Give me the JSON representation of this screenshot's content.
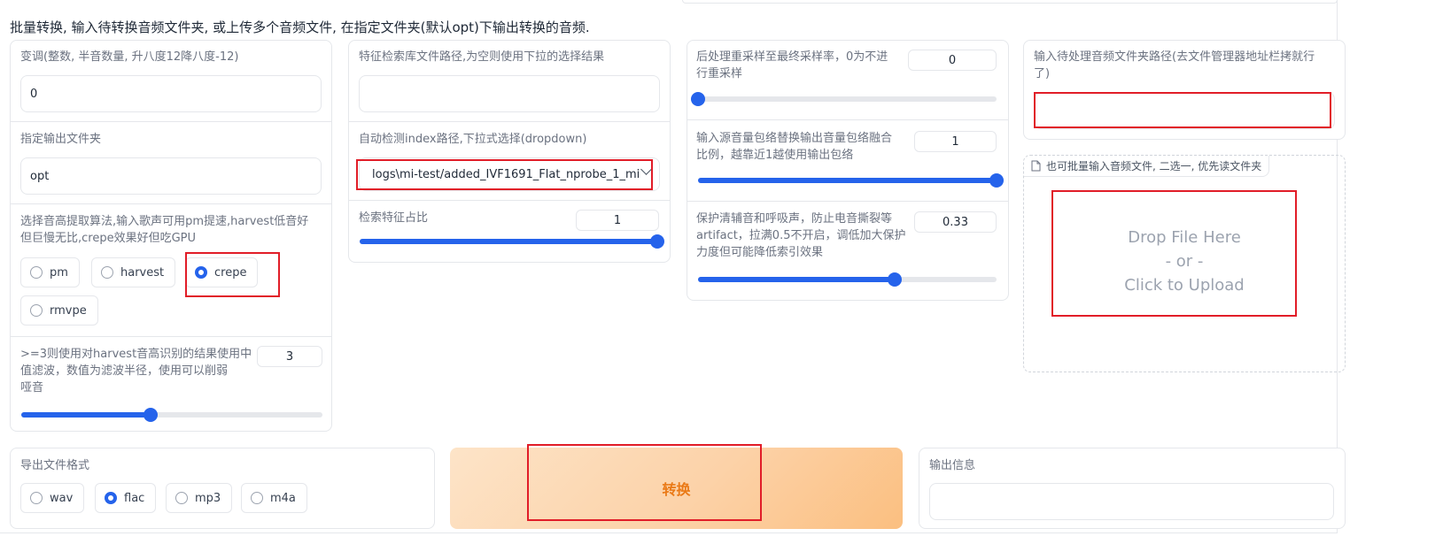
{
  "heading": "批量转换, 输入待转换音频文件夹, 或上传多个音频文件, 在指定文件夹(默认opt)下输出转换的音频.",
  "col1": {
    "transpose_label": "变调(整数, 半音数量, 升八度12降八度-12)",
    "transpose_value": "0",
    "output_folder_label": "指定输出文件夹",
    "output_folder_value": "opt",
    "pitch_label_line1": "选择音高提取算法,输入歌声可用pm提速,harvest低音好",
    "pitch_label_line2": "但巨慢无比,crepe效果好但吃GPU",
    "pitch_options": [
      "pm",
      "harvest",
      "crepe",
      "rmvpe"
    ],
    "pitch_selected": "crepe",
    "median_label_line1": ">=3则使用对harvest音高识别的结果使用中",
    "median_label_line2": "值滤波，数值为滤波半径，使用可以削弱",
    "median_label_line3": "哑音",
    "median_value": "3",
    "median_slider_fraction": 0.43
  },
  "col2": {
    "index_path_label": "特征检索库文件路径,为空则使用下拉的选择结果",
    "index_path_value": "",
    "auto_index_label": "自动检测index路径,下拉式选择(dropdown)",
    "auto_index_value": "logs\\mi-test/added_IVF1691_Flat_nprobe_1_mi",
    "index_rate_label": "检索特征占比",
    "index_rate_value": "1",
    "index_rate_fraction": 1.0
  },
  "col3": {
    "resample_label_line1": "后处理重采样至最终采样率，0为不进",
    "resample_label_line2": "行重采样",
    "resample_value": "0",
    "resample_fraction": 0.0,
    "rms_label_line1": "输入源音量包络替换输出音量包络融合",
    "rms_label_line2": "比例，越靠近1越使用输出包络",
    "rms_value": "1",
    "rms_fraction": 1.0,
    "protect_label_line1": "保护清辅音和呼吸声，防止电音撕裂等",
    "protect_label_line2": "artifact，拉满0.5不开启，调低加大保护",
    "protect_label_line3": "力度但可能降低索引效果",
    "protect_value": "0.33",
    "protect_fraction": 0.66
  },
  "col4": {
    "input_dir_label_line1": "输入待处理音频文件夹路径(去文件管理器地址栏拷就行",
    "input_dir_label_line2": "了)",
    "input_dir_value": "",
    "upload_tab_label": "也可批量输入音频文件, 二选一, 优先读文件夹",
    "drop_line1": "Drop File Here",
    "drop_line2": "- or -",
    "drop_line3": "Click to Upload"
  },
  "bottom": {
    "format_label": "导出文件格式",
    "format_options": [
      "wav",
      "flac",
      "mp3",
      "m4a"
    ],
    "format_selected": "flac",
    "convert_button": "转换",
    "output_info_label": "输出信息",
    "output_info_value": ""
  },
  "colors": {
    "accent": "#2563eb",
    "highlight": "#e11d28",
    "convert_text": "#ea7a17"
  },
  "icons": {
    "upload_tab": "file-icon",
    "dropdown": "chevron-down-icon"
  }
}
